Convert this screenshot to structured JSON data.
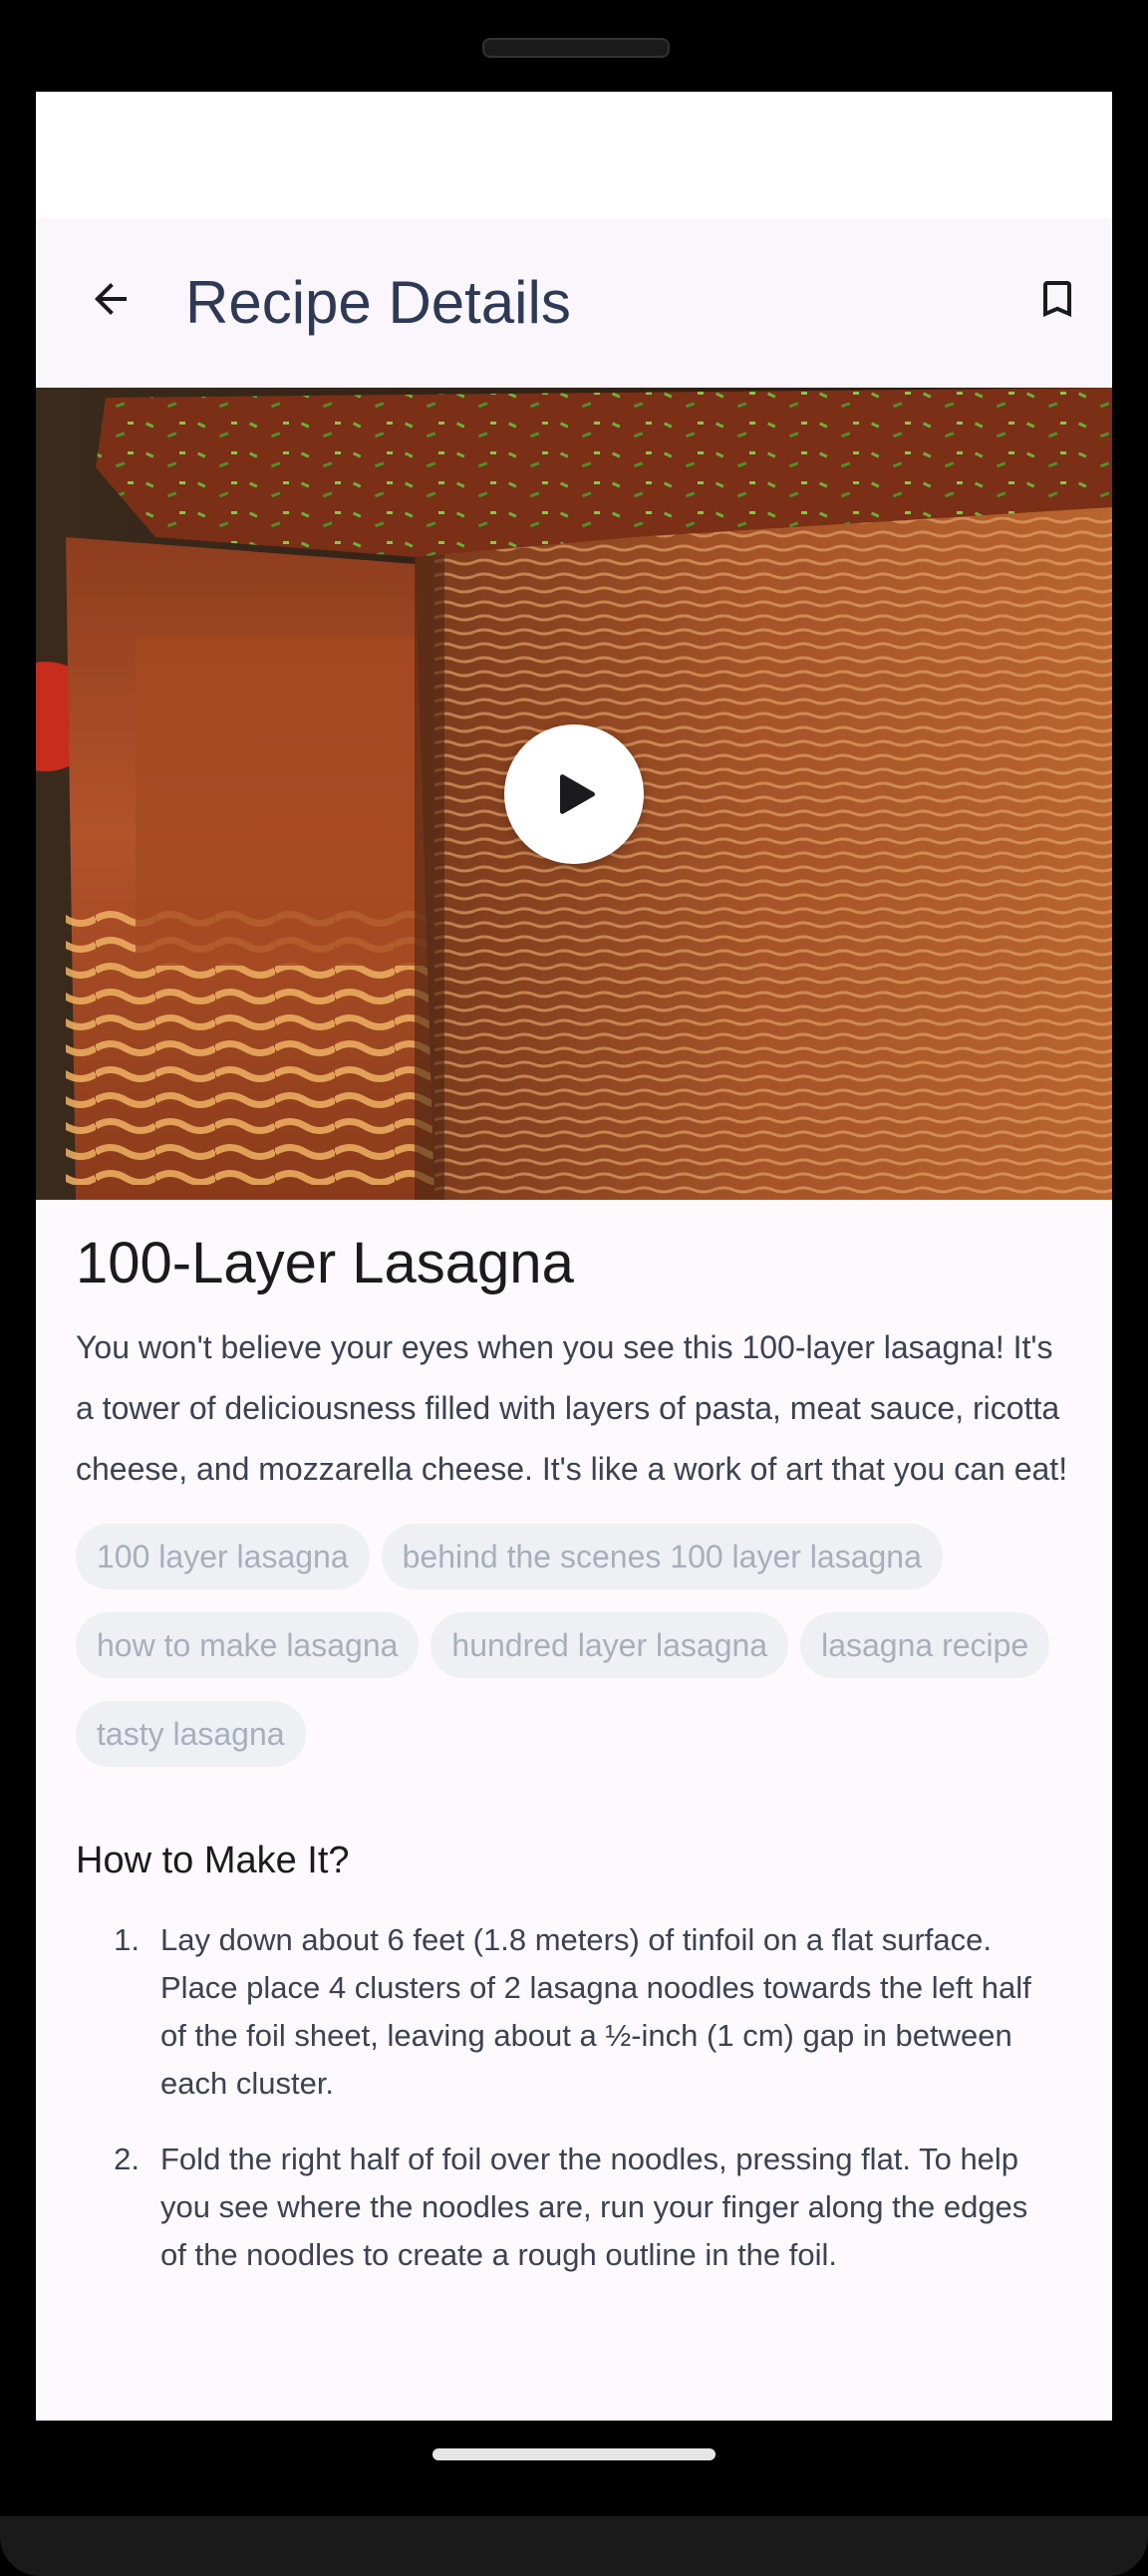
{
  "app_bar": {
    "title": "Recipe Details",
    "back_icon": "arrow-back-icon",
    "bookmark_icon": "bookmark-outline-icon"
  },
  "media": {
    "play_icon": "play-icon",
    "kind": "video-thumbnail"
  },
  "recipe": {
    "title": "100-Layer Lasagna",
    "description": "You won't believe your eyes when you see this 100-layer lasagna! It's a tower of deliciousness filled with layers of pasta, meat sauce, ricotta cheese, and mozzarella cheese. It's like a work of art that you can eat!",
    "tags": [
      "100 layer lasagna",
      "behind the scenes 100 layer lasagna",
      "how to make lasagna",
      "hundred layer lasagna",
      "lasagna recipe",
      "tasty lasagna"
    ]
  },
  "instructions": {
    "heading": "How to Make It?",
    "steps": [
      {
        "num": "1.",
        "text": "Lay down about 6 feet (1.8 meters) of tinfoil on a flat surface. Place place 4 clusters of 2 lasagna noodles towards the left half of the foil sheet, leaving about a ½-inch (1 cm) gap in between each cluster."
      },
      {
        "num": "2.",
        "text": "Fold the right half of foil over the noodles, pressing flat. To help you see where the noodles are, run your finger along the edges of the noodles to create a rough outline in the foil."
      }
    ]
  },
  "colors": {
    "title_text": "#2e3a55",
    "tag_bg": "#eef0f3",
    "tag_text": "#a7afbb",
    "surface": "#fdf9fd"
  }
}
